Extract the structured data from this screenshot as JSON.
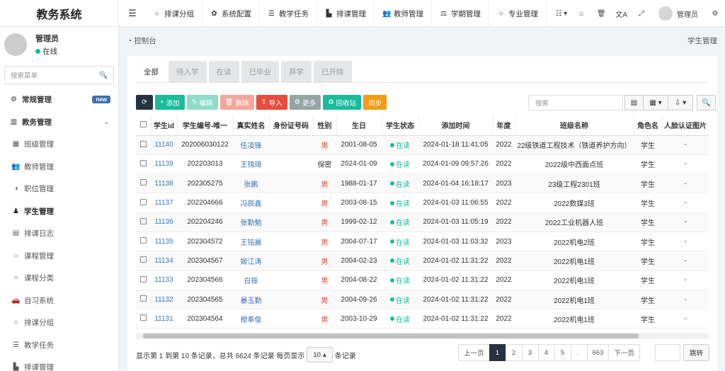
{
  "app": {
    "title": "教务系统"
  },
  "topnav": [
    {
      "icon": "○",
      "label": "排课分组"
    },
    {
      "icon": "✿",
      "label": "系统配置"
    },
    {
      "icon": "☰",
      "label": "教学任务"
    },
    {
      "icon": "▙",
      "label": "排课管理"
    },
    {
      "icon": "👥",
      "label": "教师管理"
    },
    {
      "icon": "⚖",
      "label": "学期管理"
    },
    {
      "icon": "○",
      "label": "专业管理"
    }
  ],
  "topright": {
    "user": "管理员"
  },
  "profile": {
    "name": "管理员",
    "status": "在线"
  },
  "sidebar": {
    "search_placeholder": "搜索菜单",
    "items": [
      {
        "icon": "⚙",
        "label": "常规管理",
        "badge": "new"
      },
      {
        "icon": "▥",
        "label": "教务管理"
      },
      {
        "icon": "▦",
        "label": "班级管理"
      },
      {
        "icon": "👥",
        "label": "教师管理"
      },
      {
        "icon": "◑",
        "label": "职位管理"
      },
      {
        "icon": "♟",
        "label": "学生管理"
      },
      {
        "icon": "▤",
        "label": "排课日志"
      },
      {
        "icon": "○",
        "label": "课程管理"
      },
      {
        "icon": "○",
        "label": "课程分类"
      },
      {
        "icon": "🚗",
        "label": "自习系统"
      },
      {
        "icon": "○",
        "label": "排课分组"
      },
      {
        "icon": "☰",
        "label": "教学任务"
      },
      {
        "icon": "▙",
        "label": "排课管理"
      }
    ]
  },
  "breadcrumb": {
    "home": "控制台",
    "current": "学生管理"
  },
  "tabs": [
    "全部",
    "待入学",
    "在读",
    "已毕业",
    "弃学",
    "已开除"
  ],
  "toolbar": {
    "add": "添加",
    "edit": "编辑",
    "delete": "删除",
    "import": "导入",
    "more": "更多",
    "recycle": "回收站",
    "sync": "同步",
    "search_placeholder": "搜索"
  },
  "table": {
    "columns": [
      "学生id",
      "学生编号-唯一",
      "真实姓名",
      "身份证号码",
      "性别",
      "生日",
      "学生状态",
      "添加时间",
      "年度",
      "班级名称",
      "角色名",
      "人脸认证图片"
    ],
    "rows": [
      {
        "id": "11140",
        "no": "202006030122",
        "name": "任凌锋",
        "idcard": "",
        "gender": "男",
        "birthday": "2001-08-05",
        "status": "在读",
        "added": "2024-01-18 11:41:05",
        "year": "2022",
        "class": "22级铁道工程技术（铁道养护方向）",
        "role": "学生",
        "face": "-"
      },
      {
        "id": "11139",
        "no": "202203013",
        "name": "王锦琦",
        "idcard": "",
        "gender": "保密",
        "birthday": "2024-01-09",
        "status": "在读",
        "added": "2024-01-09 09:57:26",
        "year": "2022",
        "class": "2022级中西面点班",
        "role": "学生",
        "face": "-"
      },
      {
        "id": "11138",
        "no": "202305275",
        "name": "张鹏",
        "idcard": "",
        "gender": "男",
        "birthday": "1988-01-17",
        "status": "在读",
        "added": "2024-01-04 16:18:17",
        "year": "2023",
        "class": "23级工程2301班",
        "role": "学生",
        "face": "-"
      },
      {
        "id": "11137",
        "no": "202204666",
        "name": "冯辰鑫",
        "idcard": "",
        "gender": "男",
        "birthday": "2003-08-15",
        "status": "在读",
        "added": "2024-01-03 11:06:55",
        "year": "2022",
        "class": "2022数媒3班",
        "role": "学生",
        "face": "-"
      },
      {
        "id": "11136",
        "no": "202204246",
        "name": "张勤勉",
        "idcard": "",
        "gender": "男",
        "birthday": "1999-02-12",
        "status": "在读",
        "added": "2024-01-03 11:05:19",
        "year": "2022",
        "class": "2022工业机器人班",
        "role": "学生",
        "face": "-"
      },
      {
        "id": "11135",
        "no": "202304572",
        "name": "王铭晨",
        "idcard": "",
        "gender": "男",
        "birthday": "2004-07-17",
        "status": "在读",
        "added": "2024-01-03 11:03:32",
        "year": "2023",
        "class": "2022机电2班",
        "role": "学生",
        "face": "-"
      },
      {
        "id": "11134",
        "no": "202304567",
        "name": "姬江涛",
        "idcard": "",
        "gender": "男",
        "birthday": "2004-02-23",
        "status": "在读",
        "added": "2024-01-02 11:31:22",
        "year": "2022",
        "class": "2022机电1班",
        "role": "学生",
        "face": "-"
      },
      {
        "id": "11133",
        "no": "202304566",
        "name": "白振",
        "idcard": "",
        "gender": "男",
        "birthday": "2004-08-22",
        "status": "在读",
        "added": "2024-01-02 11:31:22",
        "year": "2022",
        "class": "2022机电1班",
        "role": "学生",
        "face": "-"
      },
      {
        "id": "11132",
        "no": "202304565",
        "name": "暴玉勤",
        "idcard": "",
        "gender": "男",
        "birthday": "2004-09-26",
        "status": "在读",
        "added": "2024-01-02 11:31:22",
        "year": "2022",
        "class": "2022机电1班",
        "role": "学生",
        "face": "-"
      },
      {
        "id": "11131",
        "no": "202304564",
        "name": "穆奉俊",
        "idcard": "",
        "gender": "男",
        "birthday": "2003-10-29",
        "status": "在读",
        "added": "2024-01-02 11:31:22",
        "year": "2022",
        "class": "2022机电1班",
        "role": "学生",
        "face": "-"
      }
    ]
  },
  "footer": {
    "summary": "显示第 1 到第 10 条记录，总共 6624 条记录 每页显示",
    "page_size": "10",
    "suffix": "条记录"
  },
  "pager": {
    "prev": "上一页",
    "pages": [
      "1",
      "2",
      "3",
      "4",
      "5",
      "...",
      "663"
    ],
    "next": "下一页",
    "jump": "跳转"
  },
  "colors": {
    "primary": "#18bc9c",
    "dark": "#263241",
    "link": "#3a75b5",
    "danger": "#e74c3c"
  }
}
